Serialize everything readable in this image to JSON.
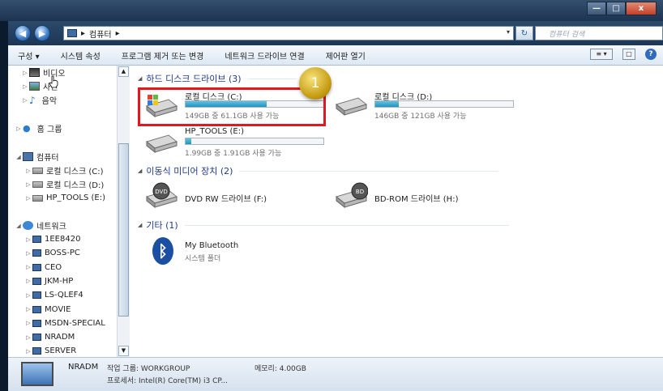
{
  "window": {
    "min": "—",
    "max": "□",
    "close": "x"
  },
  "nav": {
    "back": "◀",
    "forward": "▶",
    "breadcrumb": [
      "▸",
      "컴퓨터",
      "▸"
    ],
    "dropdown": "▾",
    "refresh": "↻",
    "search_placeholder": "컴퓨터 검색"
  },
  "toolbar": {
    "items": [
      "구성 ▾",
      "시스템 속성",
      "프로그램 제거 또는 변경",
      "네트워크 드라이브 연결",
      "제어판 열기"
    ],
    "view": "≡ ▾",
    "pane": "□",
    "help": "?"
  },
  "sidebar": {
    "favorites": [
      {
        "label": "비디오"
      },
      {
        "label": "사진"
      },
      {
        "label": "음악"
      }
    ],
    "homegroup": "홈 그룹",
    "computer": "컴퓨터",
    "computer_children": [
      "로컬 디스크 (C:)",
      "로컬 디스크 (D:)",
      "HP_TOOLS (E:)"
    ],
    "network": "네트워크",
    "network_children": [
      "1EE8420",
      "BOSS-PC",
      "CEO",
      "JKM-HP",
      "LS-QLEF4",
      "MOVIE",
      "MSDN-SPECIAL",
      "NRADM",
      "SERVER"
    ]
  },
  "groups": {
    "hdd": "하드 디스크 드라이브 (3)",
    "removable": "이동식 미디어 장치 (2)",
    "other": "기타 (1)"
  },
  "drives": [
    {
      "name": "로컬 디스크 (C:)",
      "free": "149GB 중 61.1GB 사용 가능",
      "used_fraction": 0.59
    },
    {
      "name": "로컬 디스크 (D:)",
      "free": "146GB 중 121GB 사용 가능",
      "used_fraction": 0.17
    },
    {
      "name": "HP_TOOLS (E:)",
      "free": "1.99GB 중 1.91GB 사용 가능",
      "used_fraction": 0.04
    }
  ],
  "removable": [
    {
      "name": "DVD RW 드라이브 (F:)",
      "label": "DVD"
    },
    {
      "name": "BD-ROM 드라이브 (H:)",
      "label": "BD"
    }
  ],
  "other": {
    "name": "My Bluetooth",
    "sub": "시스템 폴더"
  },
  "annotation": {
    "badge": "1"
  },
  "details": {
    "name": "NRADM",
    "workgroup": "작업 그룹: WORKGROUP",
    "memory": "메모리: 4.00GB",
    "cpu": "프로세서: Intel(R) Core(TM) i3 CP..."
  },
  "colors": {
    "accent": "#2693be",
    "highlight": "#e0191f",
    "badge": "#c49b12"
  }
}
